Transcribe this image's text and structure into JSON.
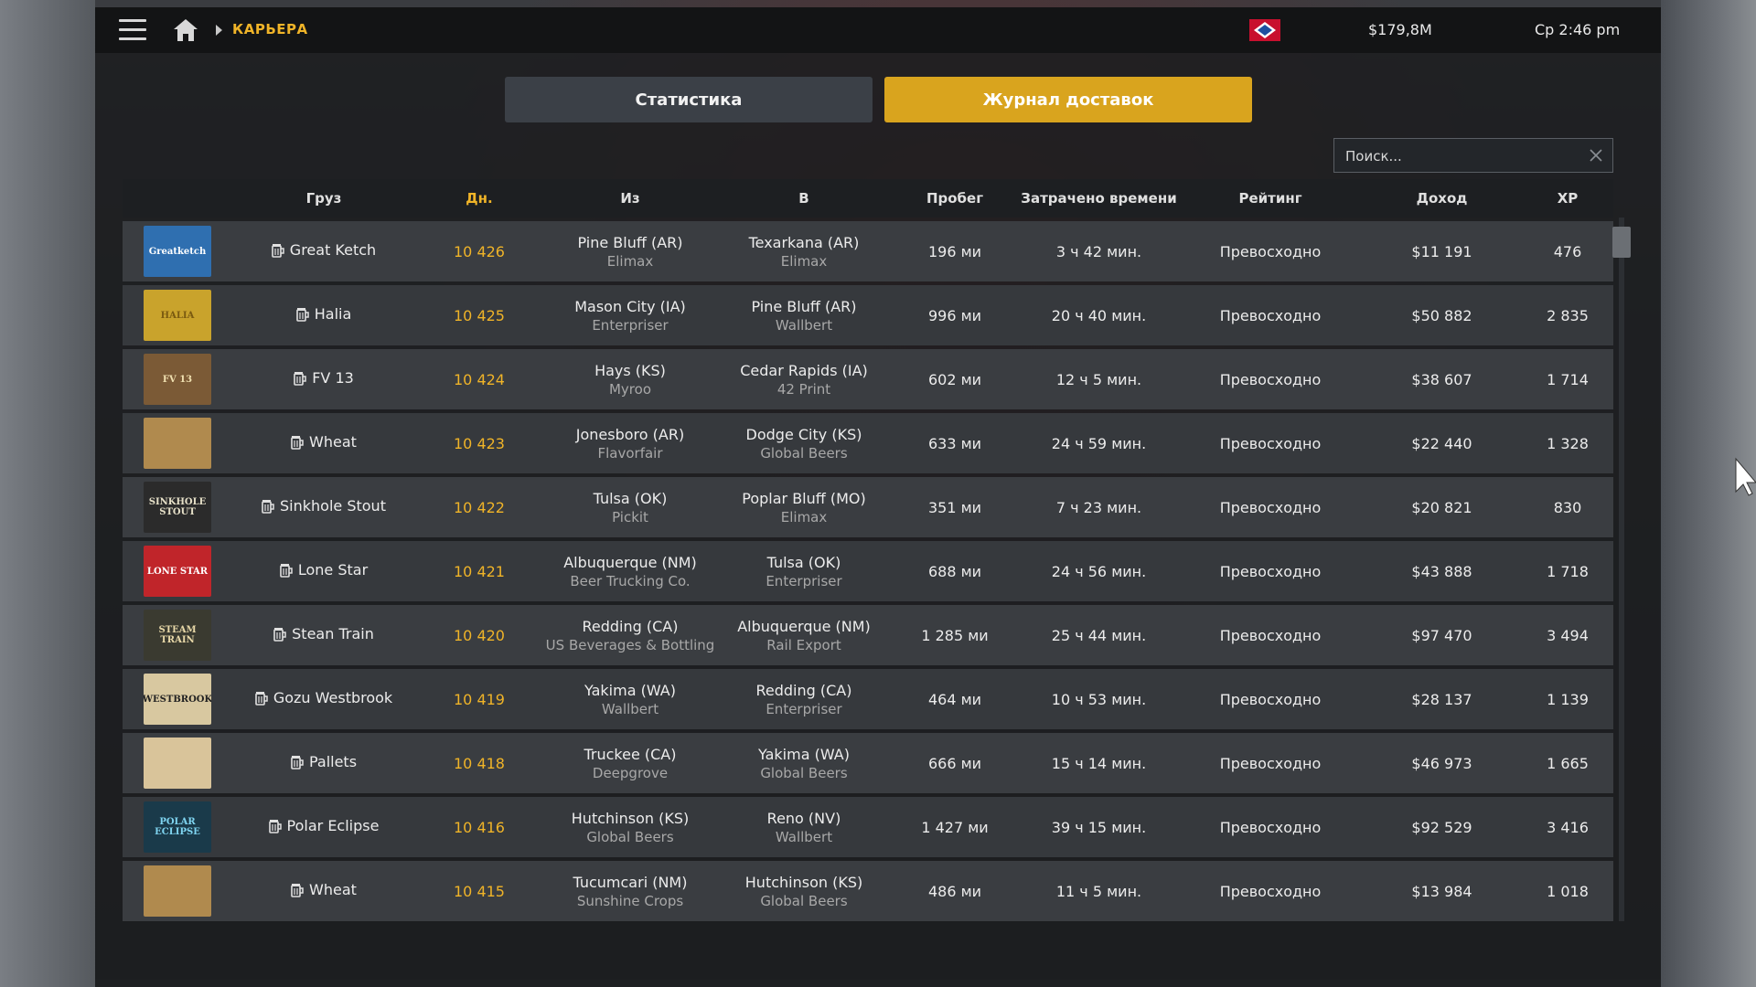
{
  "topbar": {
    "breadcrumb": "КАРЬЕРА",
    "money": "$179,8M",
    "clock": "Ср 2:46 pm",
    "icons": [
      "menu-icon",
      "home-icon",
      "chevron-right-icon",
      "arkansas-flag-icon"
    ]
  },
  "tabs": {
    "stats": "Статистика",
    "log": "Журнал доставок"
  },
  "search": {
    "placeholder": "Поиск...",
    "value": ""
  },
  "columns": {
    "cargo": "Груз",
    "day": "Дн.",
    "from": "Из",
    "to": "В",
    "distance": "Пробег",
    "time": "Затрачено времени",
    "rating": "Рейтинг",
    "income": "Доход",
    "xp": "XP"
  },
  "rows": [
    {
      "cargo": "Great Ketch",
      "day": "10 426",
      "from_city": "Pine Bluff (AR)",
      "from_company": "Elimax",
      "to_city": "Texarkana (AR)",
      "to_company": "Elimax",
      "distance": "196 ми",
      "time": "3 ч 42 мин.",
      "rating": "Превосходно",
      "income": "$11 191",
      "xp": "476"
    },
    {
      "cargo": "Halia",
      "day": "10 425",
      "from_city": "Mason City (IA)",
      "from_company": "Enterpriser",
      "to_city": "Pine Bluff (AR)",
      "to_company": "Wallbert",
      "distance": "996 ми",
      "time": "20 ч 40 мин.",
      "rating": "Превосходно",
      "income": "$50 882",
      "xp": "2 835"
    },
    {
      "cargo": "FV 13",
      "day": "10 424",
      "from_city": "Hays (KS)",
      "from_company": "Myroo",
      "to_city": "Cedar Rapids (IA)",
      "to_company": "42 Print",
      "distance": "602 ми",
      "time": "12 ч 5 мин.",
      "rating": "Превосходно",
      "income": "$38 607",
      "xp": "1 714"
    },
    {
      "cargo": "Wheat",
      "day": "10 423",
      "from_city": "Jonesboro (AR)",
      "from_company": "Flavorfair",
      "to_city": "Dodge City (KS)",
      "to_company": "Global Beers",
      "distance": "633 ми",
      "time": "24 ч 59 мин.",
      "rating": "Превосходно",
      "income": "$22 440",
      "xp": "1 328"
    },
    {
      "cargo": "Sinkhole Stout",
      "day": "10 422",
      "from_city": "Tulsa (OK)",
      "from_company": "Pickit",
      "to_city": "Poplar Bluff (MO)",
      "to_company": "Elimax",
      "distance": "351 ми",
      "time": "7 ч 23 мин.",
      "rating": "Превосходно",
      "income": "$20 821",
      "xp": "830"
    },
    {
      "cargo": "Lone Star",
      "day": "10 421",
      "from_city": "Albuquerque (NM)",
      "from_company": "Beer Trucking Co.",
      "to_city": "Tulsa (OK)",
      "to_company": "Enterpriser",
      "distance": "688 ми",
      "time": "24 ч 56 мин.",
      "rating": "Превосходно",
      "income": "$43 888",
      "xp": "1 718"
    },
    {
      "cargo": "Stean Train",
      "day": "10 420",
      "from_city": "Redding (CA)",
      "from_company": "US Beverages & Bottling",
      "to_city": "Albuquerque (NM)",
      "to_company": "Rail Export",
      "distance": "1 285 ми",
      "time": "25 ч 44 мин.",
      "rating": "Превосходно",
      "income": "$97 470",
      "xp": "3 494"
    },
    {
      "cargo": "Gozu Westbrook",
      "day": "10 419",
      "from_city": "Yakima (WA)",
      "from_company": "Wallbert",
      "to_city": "Redding (CA)",
      "to_company": "Enterpriser",
      "distance": "464 ми",
      "time": "10 ч 53 мин.",
      "rating": "Превосходно",
      "income": "$28 137",
      "xp": "1 139"
    },
    {
      "cargo": "Pallets",
      "day": "10 418",
      "from_city": "Truckee (CA)",
      "from_company": "Deepgrove",
      "to_city": "Yakima (WA)",
      "to_company": "Global Beers",
      "distance": "666 ми",
      "time": "15 ч 14 мин.",
      "rating": "Превосходно",
      "income": "$46 973",
      "xp": "1 665"
    },
    {
      "cargo": "Polar Eclipse",
      "day": "10 416",
      "from_city": "Hutchinson (KS)",
      "from_company": "Global Beers",
      "to_city": "Reno (NV)",
      "to_company": "Wallbert",
      "distance": "1 427 ми",
      "time": "39 ч 15 мин.",
      "rating": "Превосходно",
      "income": "$92 529",
      "xp": "3 416"
    },
    {
      "cargo": "Wheat",
      "day": "10 415",
      "from_city": "Tucumcari (NM)",
      "from_company": "Sunshine Crops",
      "to_city": "Hutchinson (KS)",
      "to_company": "Global Beers",
      "distance": "486 ми",
      "time": "11 ч 5 мин.",
      "rating": "Превосходно",
      "income": "$13 984",
      "xp": "1 018"
    }
  ],
  "thumbs": [
    {
      "label": "Greatketch",
      "bg": "#2f6fb0",
      "fg": "#ffffff"
    },
    {
      "label": "HALIA",
      "bg": "#c9a32c",
      "fg": "#7a5a10"
    },
    {
      "label": "FV 13",
      "bg": "#7b5a36",
      "fg": "#f0e0b0"
    },
    {
      "label": "",
      "bg": "#b08a4e",
      "fg": "#b08a4e"
    },
    {
      "label": "SINKHOLE STOUT",
      "bg": "#2b2b2b",
      "fg": "#e6e0c8"
    },
    {
      "label": "LONE STAR",
      "bg": "#c0252a",
      "fg": "#ffffff"
    },
    {
      "label": "STEAM TRAIN",
      "bg": "#3a3a30",
      "fg": "#e8d8a8"
    },
    {
      "label": "WESTBROOK",
      "bg": "#d8c8a0",
      "fg": "#222222"
    },
    {
      "label": "",
      "bg": "#d9c49a",
      "fg": "#d9c49a"
    },
    {
      "label": "POLAR ECLIPSE",
      "bg": "#1a3a4a",
      "fg": "#7fd4f0"
    },
    {
      "label": "",
      "bg": "#b08a4e",
      "fg": "#b08a4e"
    }
  ],
  "colors": {
    "accent": "#f0b428",
    "tab_active": "#d9a41e",
    "tab_inactive": "#3b4047"
  }
}
